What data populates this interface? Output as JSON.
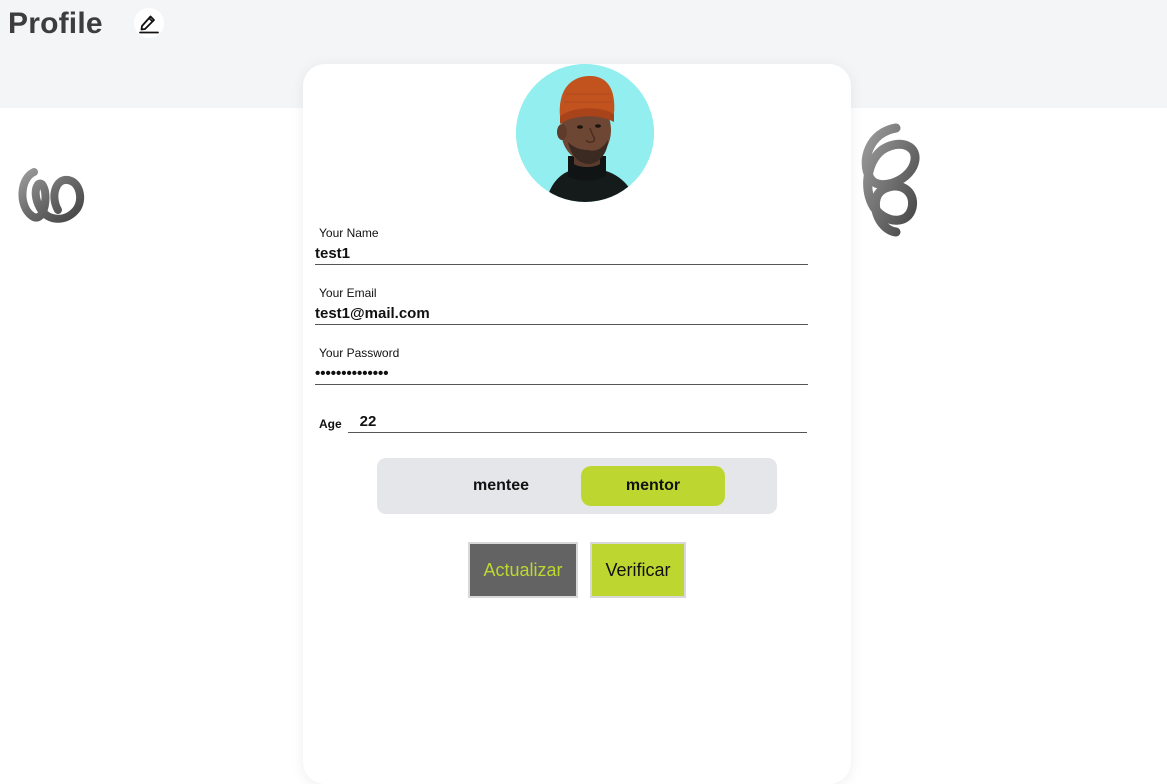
{
  "header": {
    "title": "Profile",
    "edit_icon": "pencil-edit-icon"
  },
  "profile": {
    "avatar_icon": "user-avatar-photo",
    "fields": {
      "name": {
        "label": "Your Name",
        "value": "test1"
      },
      "email": {
        "label": "Your Email",
        "value": "test1@mail.com"
      },
      "password": {
        "label": "Your Password",
        "value": "••••••••••••••"
      },
      "age": {
        "label": "Age",
        "value": "22"
      }
    },
    "role_toggle": {
      "options": [
        "mentee",
        "mentor"
      ],
      "selected": "mentor"
    },
    "buttons": {
      "update": "Actualizar",
      "verify": "Verificar"
    }
  },
  "decorations": {
    "left_icon": "coil-spring-icon",
    "right_icon": "coil-spring-icon"
  },
  "colors": {
    "accent": "#bdd730",
    "dark_button": "#636363",
    "header_bg": "#f4f5f7",
    "toggle_bg": "#e5e6ea",
    "avatar_bg": "#92eeef"
  }
}
